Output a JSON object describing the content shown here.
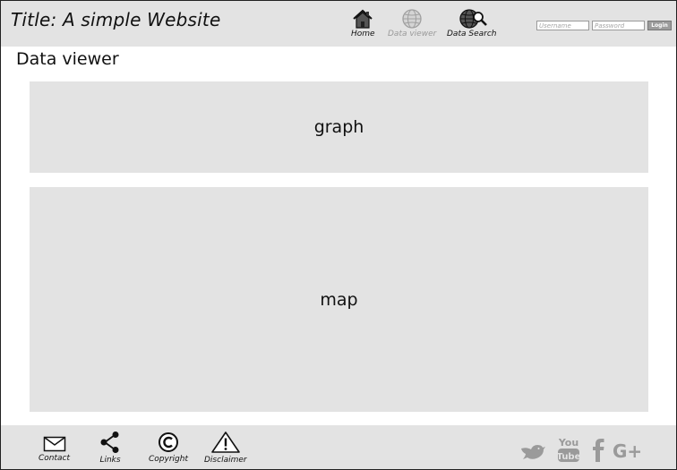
{
  "header": {
    "title": "Title: A simple Website",
    "nav": [
      {
        "label": "Home",
        "icon": "home-icon"
      },
      {
        "label": "Data viewer",
        "icon": "globe-icon"
      },
      {
        "label": "Data Search",
        "icon": "globe-search-icon"
      }
    ],
    "login": {
      "username_placeholder": "Username",
      "password_placeholder": "Password",
      "login_label": "Login"
    }
  },
  "main": {
    "page_title": "Data viewer",
    "graph_label": "graph",
    "map_label": "map"
  },
  "footer": {
    "items": [
      {
        "label": "Contact",
        "icon": "envelope-icon"
      },
      {
        "label": "Links",
        "icon": "share-icon"
      },
      {
        "label": "Copyright",
        "icon": "copyright-icon"
      },
      {
        "label": "Disclaimer",
        "icon": "warning-icon"
      }
    ],
    "social": [
      {
        "name": "twitter",
        "icon": "twitter-icon"
      },
      {
        "name": "youtube",
        "icon": "youtube-icon"
      },
      {
        "name": "facebook",
        "icon": "facebook-icon"
      },
      {
        "name": "google-plus",
        "icon": "google-plus-icon"
      }
    ]
  },
  "colors": {
    "bar_background": "#e3e3e3",
    "panel_background": "#e3e3e3",
    "inactive_nav": "#9a9a9a",
    "social_gray": "#9a9a9a"
  }
}
